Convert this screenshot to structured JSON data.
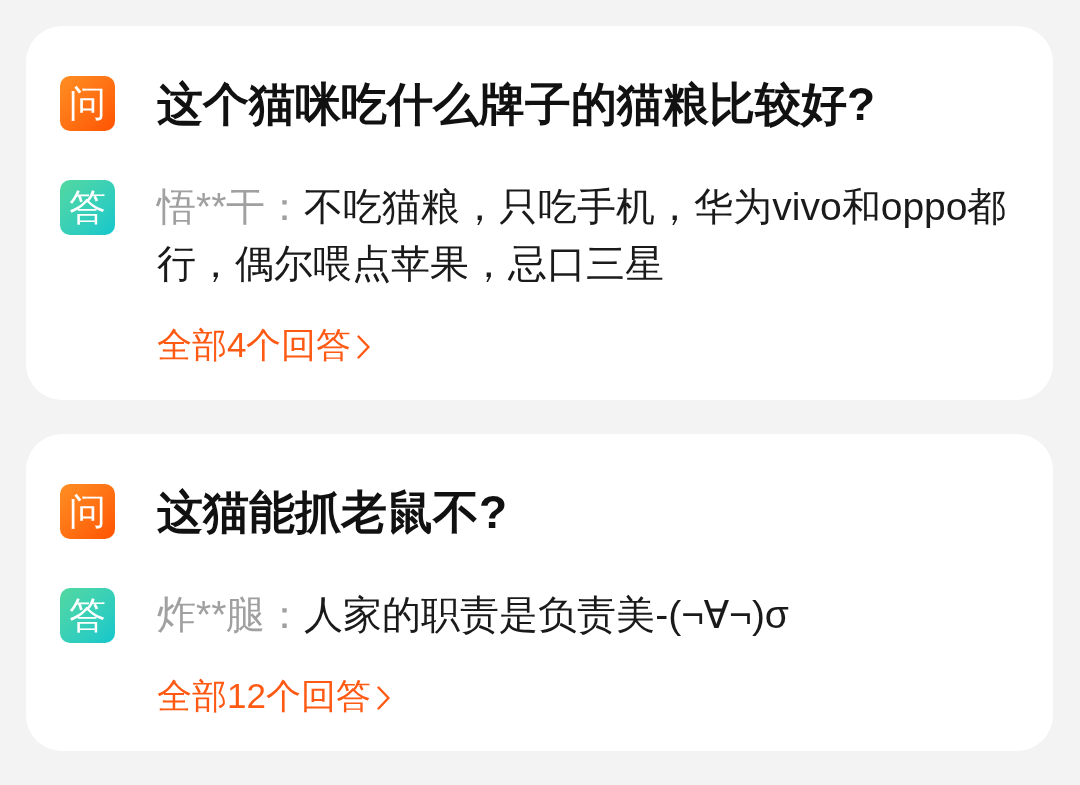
{
  "questions": [
    {
      "badge": "问",
      "question": "这个猫咪吃什么牌子的猫粮比较好?",
      "answer": {
        "badge": "答",
        "author": "悟**干：",
        "text": "不吃猫粮，只吃手机，华为vivo和oppo都行，偶尔喂点苹果，忌口三星"
      },
      "all_answers_link": "全部4个回答"
    },
    {
      "badge": "问",
      "question": "这猫能抓老鼠不?",
      "answer": {
        "badge": "答",
        "author": "炸**腿：",
        "text": "人家的职责是负责美-(¬∀¬)σ"
      },
      "all_answers_link": "全部12个回答"
    }
  ]
}
